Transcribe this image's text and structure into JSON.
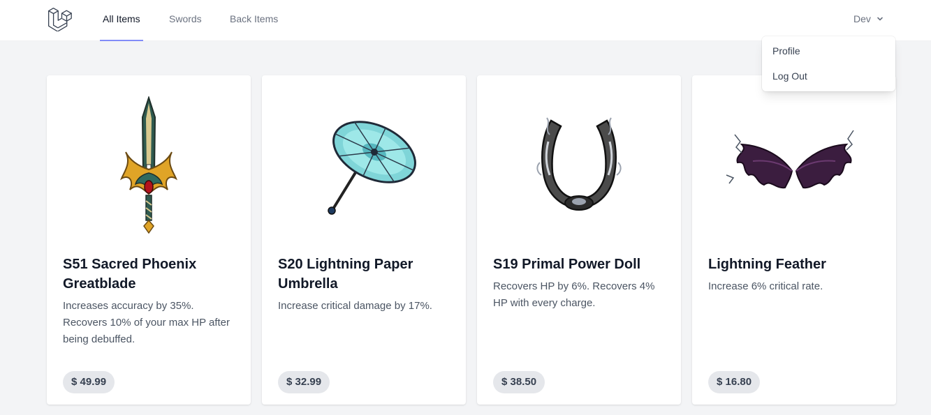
{
  "nav": {
    "tabs": [
      {
        "label": "All Items",
        "active": true
      },
      {
        "label": "Swords",
        "active": false
      },
      {
        "label": "Back Items",
        "active": false
      }
    ],
    "user_name": "Dev",
    "dropdown": {
      "profile": "Profile",
      "logout": "Log Out"
    }
  },
  "colors": {
    "accent": "#818cf8",
    "background": "#f3f4f6",
    "card": "#ffffff",
    "price_badge": "#e5e7eb"
  },
  "items": [
    {
      "title": "S51 Sacred Phoenix Greatblade",
      "description": "Increases accuracy by 35%. Recovers 10% of your max HP after being debuffed.",
      "price": "$ 49.99",
      "image": "sacred-phoenix-greatblade-sword"
    },
    {
      "title": "S20 Lightning Paper Umbrella",
      "description": "Increase critical damage by 17%.",
      "price": "$ 32.99",
      "image": "lightning-paper-umbrella"
    },
    {
      "title": "S19 Primal Power Doll",
      "description": "Recovers HP by 6%. Recovers 4% HP with every charge.",
      "price": "$ 38.50",
      "image": "primal-power-doll-horns"
    },
    {
      "title": "Lightning Feather",
      "description": "Increase 6% critical rate.",
      "price": "$ 16.80",
      "image": "lightning-feather-wings"
    }
  ]
}
